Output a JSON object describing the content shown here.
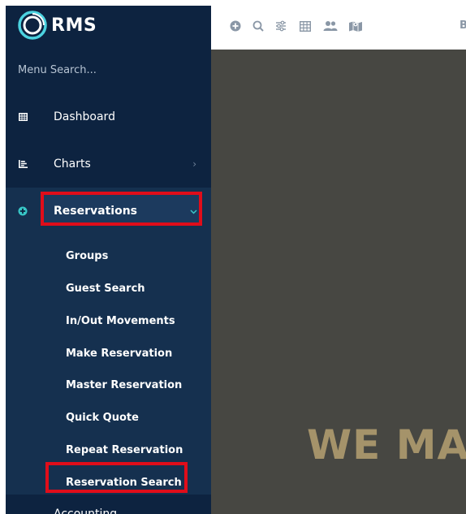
{
  "brand": {
    "logo_text": "RMS"
  },
  "sidebar": {
    "menu_search_placeholder": "Menu Search...",
    "items": [
      {
        "label": "Dashboard",
        "icon": "grid-icon"
      },
      {
        "label": "Charts",
        "icon": "bar-chart-icon"
      },
      {
        "label": "Reservations",
        "icon": "plus-circle-icon",
        "expanded": true
      }
    ],
    "reservations_submenu": [
      "Groups",
      "Guest Search",
      "In/Out Movements",
      "Make Reservation",
      "Master Reservation",
      "Quick Quote",
      "Repeat Reservation",
      "Reservation Search"
    ],
    "next_item_label": "Accounting"
  },
  "toolbar": {
    "icons": [
      "add-icon",
      "search-icon",
      "sliders-icon",
      "grid-icon",
      "users-icon",
      "map-icon"
    ],
    "overflow_text": "B"
  },
  "hero": {
    "text": "WE MA"
  },
  "colors": {
    "sidebar_bg": "#0d2340",
    "submenu_bg": "#15304f",
    "highlight_red": "#e00d1a",
    "accent_teal": "#38c7c7",
    "hero_bg": "#474742",
    "hero_text": "#a5936a"
  }
}
